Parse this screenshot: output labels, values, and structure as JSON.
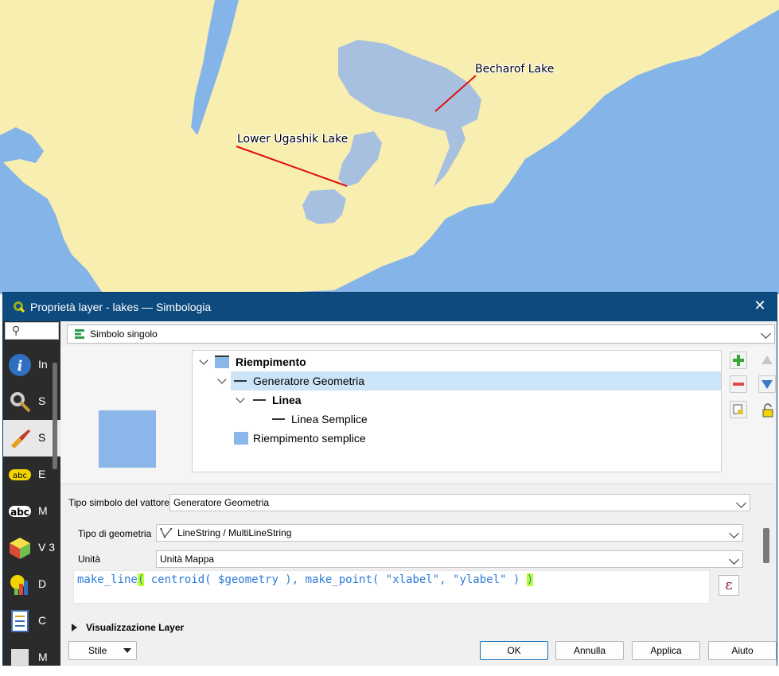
{
  "map": {
    "colors": {
      "water": "#85b4e8",
      "land": "#f8eeb0",
      "lake": "#a8c0e0",
      "leader": "#e01010"
    },
    "labels": [
      {
        "text": "Becharof Lake"
      },
      {
        "text": "Lower Ugashik Lake"
      }
    ]
  },
  "dialog": {
    "title": "Proprietà layer - lakes — Simbologia",
    "close_label": "✕",
    "search_icon": "search-icon",
    "sidebar": {
      "items": [
        {
          "label": "In",
          "icon": "info-icon"
        },
        {
          "label": "S",
          "icon": "source-icon"
        },
        {
          "label": "S",
          "icon": "symbology-icon"
        },
        {
          "label": "E",
          "icon": "labels-icon"
        },
        {
          "label": "M",
          "icon": "masks-icon"
        },
        {
          "label": "V 3",
          "icon": "3d-view-icon"
        },
        {
          "label": "D",
          "icon": "diagrams-icon"
        },
        {
          "label": "C",
          "icon": "fields-icon"
        },
        {
          "label": "M",
          "icon": "form-icon"
        }
      ]
    },
    "renderer": {
      "value": "Simbolo singolo"
    },
    "symbol_tree": [
      {
        "label": "Riempimento",
        "bold": true
      },
      {
        "label": "Generatore Geometria",
        "bold": false
      },
      {
        "label": "Linea",
        "bold": true
      },
      {
        "label": "Linea Semplice",
        "bold": false
      },
      {
        "label": "Riempimento semplice",
        "bold": false
      }
    ],
    "symbol_layer_type": {
      "label": "Tipo simbolo del vattore",
      "value": "Generatore Geometria"
    },
    "geometry_type": {
      "label": "Tipo di geometria",
      "value": "LineString / MultiLineString"
    },
    "units": {
      "label": "Unità",
      "value": "Unità Mappa"
    },
    "expression": {
      "func1": "make_line",
      "open1": "(",
      "mid": " centroid( $geometry ), make_point( \"xlabel\", \"ylabel\" ) ",
      "close1": ")"
    },
    "expression_button": "ε",
    "layer_rendering": "Visualizzazione Layer",
    "buttons": {
      "style": "Stile",
      "ok": "OK",
      "cancel": "Annulla",
      "apply": "Applica",
      "help": "Aiuto"
    }
  }
}
